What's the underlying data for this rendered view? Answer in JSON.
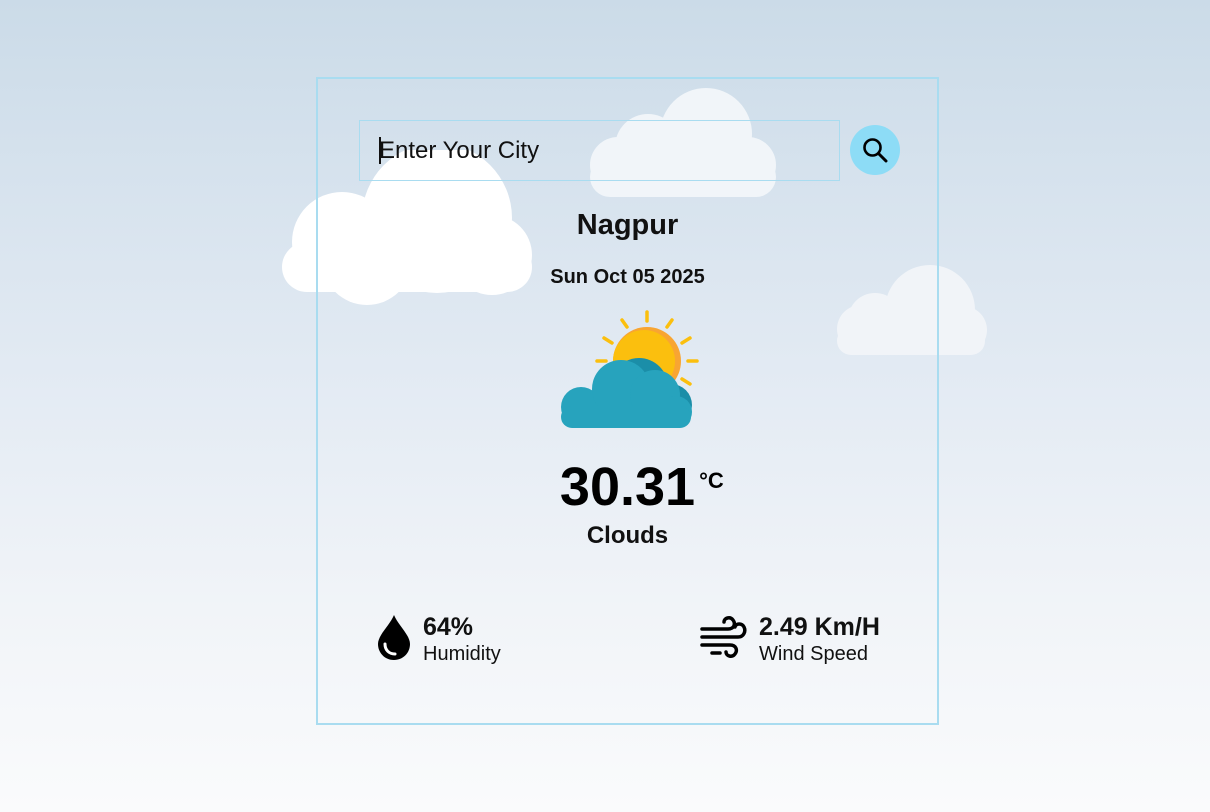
{
  "search": {
    "placeholder": "Enter Your City",
    "value": ""
  },
  "weather": {
    "city": "Nagpur",
    "date": "Sun Oct 05 2025",
    "temperature": "30.31",
    "unit": "°C",
    "condition": "Clouds",
    "condition_icon": "sun-behind-cloud-icon"
  },
  "stats": {
    "humidity_value": "64%",
    "humidity_label": "Humidity",
    "humidity_icon": "water-drop-icon",
    "wind_value": "2.49 Km/H",
    "wind_label": "Wind Speed",
    "wind_icon": "wind-icon"
  },
  "colors": {
    "accent": "#8ddcf6",
    "border": "#a9dcf0",
    "sun": "#fbbf0e",
    "cloud": "#27a3bd"
  }
}
